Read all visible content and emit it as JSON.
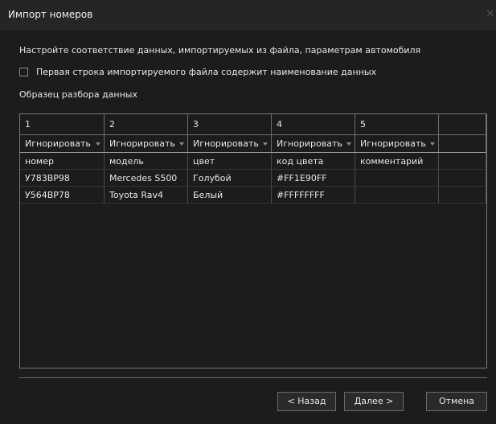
{
  "window": {
    "title": "Импорт номеров",
    "close_glyph": "×"
  },
  "instruction": "Настройте соответствие данных, импортируемых из файла, параметрам автомобиля",
  "header_checkbox": {
    "label": "Первая строка импортируемого файла содержит наименование данных",
    "checked": false
  },
  "sample_label": "Образец разбора данных",
  "grid": {
    "columns": [
      "1",
      "2",
      "3",
      "4",
      "5",
      ""
    ],
    "mapping": [
      "Игнорировать",
      "Игнорировать",
      "Игнорировать",
      "Игнорировать",
      "Игнорировать",
      ""
    ],
    "rows": [
      [
        "номер",
        "модель",
        "цвет",
        "код цвета",
        "комментарий",
        ""
      ],
      [
        "У783ВР98",
        "Mercedes S500",
        "Голубой",
        "#FF1E90FF",
        "",
        ""
      ],
      [
        "У564ВР78",
        "Toyota Rav4",
        "Белый",
        "#FFFFFFFF",
        "",
        ""
      ]
    ]
  },
  "buttons": {
    "back": "< Назад",
    "next": "Далее >",
    "cancel": "Отмена"
  }
}
